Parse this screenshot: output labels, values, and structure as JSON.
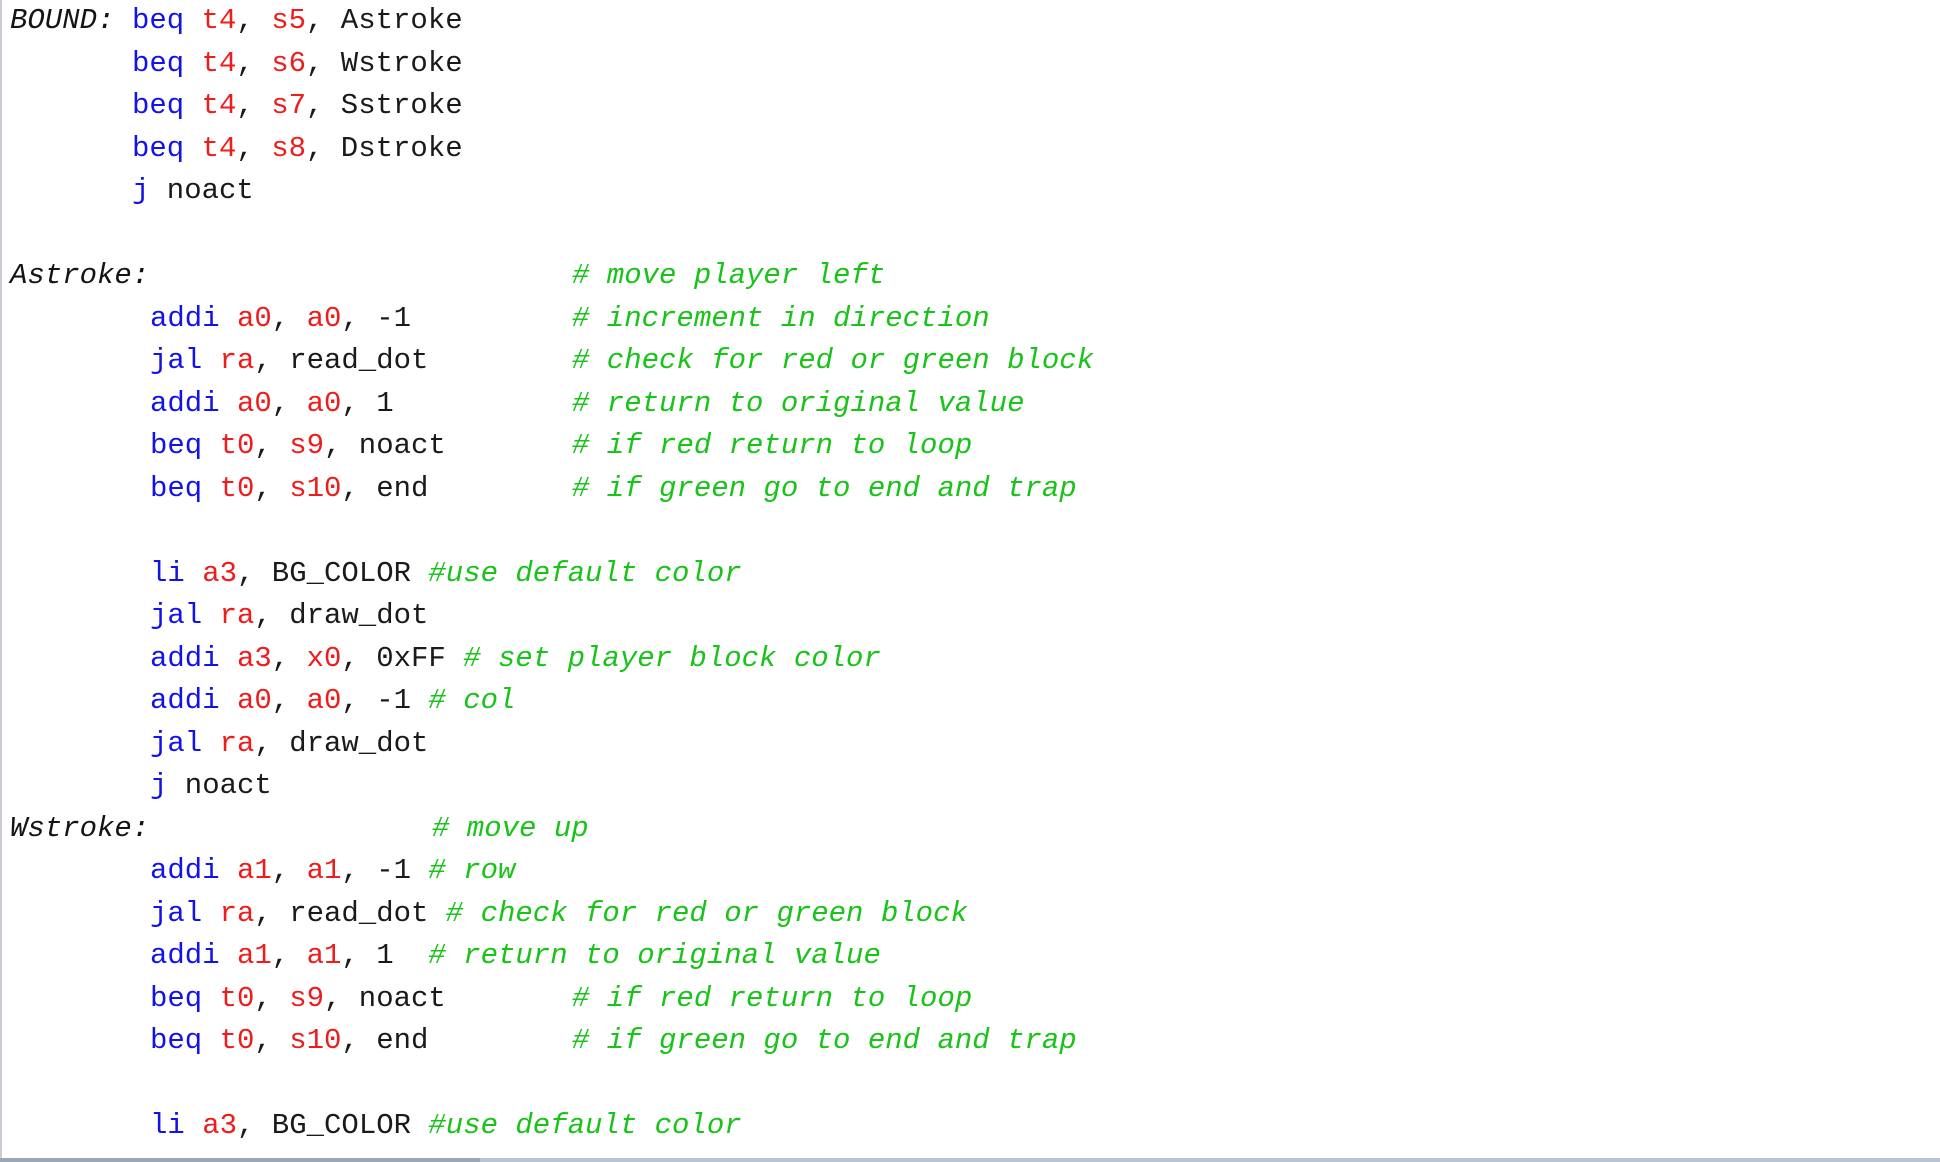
{
  "editor": {
    "lines": [
      {
        "label": "BOUND:",
        "indent": 0,
        "tokens": [
          {
            "t": "kw",
            "v": "beq"
          },
          {
            "t": "txt",
            "v": " "
          },
          {
            "t": "reg",
            "v": "t4"
          },
          {
            "t": "txt",
            "v": ", "
          },
          {
            "t": "reg",
            "v": "s5"
          },
          {
            "t": "txt",
            "v": ", Astroke"
          }
        ],
        "comment": ""
      },
      {
        "label": "",
        "indent": 0,
        "tokens": [
          {
            "t": "kw",
            "v": "beq"
          },
          {
            "t": "txt",
            "v": " "
          },
          {
            "t": "reg",
            "v": "t4"
          },
          {
            "t": "txt",
            "v": ", "
          },
          {
            "t": "reg",
            "v": "s6"
          },
          {
            "t": "txt",
            "v": ", Wstroke"
          }
        ],
        "comment": ""
      },
      {
        "label": "",
        "indent": 0,
        "tokens": [
          {
            "t": "kw",
            "v": "beq"
          },
          {
            "t": "txt",
            "v": " "
          },
          {
            "t": "reg",
            "v": "t4"
          },
          {
            "t": "txt",
            "v": ", "
          },
          {
            "t": "reg",
            "v": "s7"
          },
          {
            "t": "txt",
            "v": ", Sstroke"
          }
        ],
        "comment": ""
      },
      {
        "label": "",
        "indent": 0,
        "tokens": [
          {
            "t": "kw",
            "v": "beq"
          },
          {
            "t": "txt",
            "v": " "
          },
          {
            "t": "reg",
            "v": "t4"
          },
          {
            "t": "txt",
            "v": ", "
          },
          {
            "t": "reg",
            "v": "s8"
          },
          {
            "t": "txt",
            "v": ", Dstroke"
          }
        ],
        "comment": ""
      },
      {
        "label": "",
        "indent": 0,
        "tokens": [
          {
            "t": "kw",
            "v": "j"
          },
          {
            "t": "txt",
            "v": " noact"
          }
        ],
        "comment": ""
      },
      {
        "label": "",
        "indent": 0,
        "tokens": [],
        "comment": ""
      },
      {
        "label": "Astroke:",
        "indent": 0,
        "tokens": [],
        "comment": "# move player left"
      },
      {
        "label": "",
        "indent": 1,
        "tokens": [
          {
            "t": "kw",
            "v": "addi"
          },
          {
            "t": "txt",
            "v": " "
          },
          {
            "t": "reg",
            "v": "a0"
          },
          {
            "t": "txt",
            "v": ", "
          },
          {
            "t": "reg",
            "v": "a0"
          },
          {
            "t": "txt",
            "v": ", -1"
          }
        ],
        "comment": "# increment in direction"
      },
      {
        "label": "",
        "indent": 1,
        "tokens": [
          {
            "t": "kw",
            "v": "jal"
          },
          {
            "t": "txt",
            "v": " "
          },
          {
            "t": "reg",
            "v": "ra"
          },
          {
            "t": "txt",
            "v": ", read_dot"
          }
        ],
        "comment": "# check for red or green block"
      },
      {
        "label": "",
        "indent": 1,
        "tokens": [
          {
            "t": "kw",
            "v": "addi"
          },
          {
            "t": "txt",
            "v": " "
          },
          {
            "t": "reg",
            "v": "a0"
          },
          {
            "t": "txt",
            "v": ", "
          },
          {
            "t": "reg",
            "v": "a0"
          },
          {
            "t": "txt",
            "v": ", 1"
          }
        ],
        "comment": "# return to original value"
      },
      {
        "label": "",
        "indent": 1,
        "tokens": [
          {
            "t": "kw",
            "v": "beq"
          },
          {
            "t": "txt",
            "v": " "
          },
          {
            "t": "reg",
            "v": "t0"
          },
          {
            "t": "txt",
            "v": ", "
          },
          {
            "t": "reg",
            "v": "s9"
          },
          {
            "t": "txt",
            "v": ", noact"
          }
        ],
        "comment": "# if red return to loop"
      },
      {
        "label": "",
        "indent": 1,
        "tokens": [
          {
            "t": "kw",
            "v": "beq"
          },
          {
            "t": "txt",
            "v": " "
          },
          {
            "t": "reg",
            "v": "t0"
          },
          {
            "t": "txt",
            "v": ", "
          },
          {
            "t": "reg",
            "v": "s10"
          },
          {
            "t": "txt",
            "v": ", end"
          }
        ],
        "comment": "# if green go to end and trap"
      },
      {
        "label": "",
        "indent": 0,
        "tokens": [],
        "comment": ""
      },
      {
        "label": "",
        "indent": 1,
        "tokens": [
          {
            "t": "kw",
            "v": "li"
          },
          {
            "t": "txt",
            "v": " "
          },
          {
            "t": "reg",
            "v": "a3"
          },
          {
            "t": "txt",
            "v": ", BG_COLOR "
          },
          {
            "t": "cmt",
            "v": "#use default color"
          }
        ],
        "comment": ""
      },
      {
        "label": "",
        "indent": 1,
        "tokens": [
          {
            "t": "kw",
            "v": "jal"
          },
          {
            "t": "txt",
            "v": " "
          },
          {
            "t": "reg",
            "v": "ra"
          },
          {
            "t": "txt",
            "v": ", draw_dot"
          }
        ],
        "comment": ""
      },
      {
        "label": "",
        "indent": 1,
        "tokens": [
          {
            "t": "kw",
            "v": "addi"
          },
          {
            "t": "txt",
            "v": " "
          },
          {
            "t": "reg",
            "v": "a3"
          },
          {
            "t": "txt",
            "v": ", "
          },
          {
            "t": "reg",
            "v": "x0"
          },
          {
            "t": "txt",
            "v": ", 0xFF "
          },
          {
            "t": "cmt",
            "v": "# set player block color"
          }
        ],
        "comment": ""
      },
      {
        "label": "",
        "indent": 1,
        "tokens": [
          {
            "t": "kw",
            "v": "addi"
          },
          {
            "t": "txt",
            "v": " "
          },
          {
            "t": "reg",
            "v": "a0"
          },
          {
            "t": "txt",
            "v": ", "
          },
          {
            "t": "reg",
            "v": "a0"
          },
          {
            "t": "txt",
            "v": ", -1 "
          },
          {
            "t": "cmt",
            "v": "# col"
          }
        ],
        "comment": ""
      },
      {
        "label": "",
        "indent": 1,
        "tokens": [
          {
            "t": "kw",
            "v": "jal"
          },
          {
            "t": "txt",
            "v": " "
          },
          {
            "t": "reg",
            "v": "ra"
          },
          {
            "t": "txt",
            "v": ", draw_dot"
          }
        ],
        "comment": ""
      },
      {
        "label": "",
        "indent": 1,
        "tokens": [
          {
            "t": "kw",
            "v": "j"
          },
          {
            "t": "txt",
            "v": " noact"
          }
        ],
        "comment": ""
      },
      {
        "label": "Wstroke:",
        "indent": 0,
        "tokens": [],
        "comment": "# move up",
        "comment_col": "mid"
      },
      {
        "label": "",
        "indent": 1,
        "tokens": [
          {
            "t": "kw",
            "v": "addi"
          },
          {
            "t": "txt",
            "v": " "
          },
          {
            "t": "reg",
            "v": "a1"
          },
          {
            "t": "txt",
            "v": ", "
          },
          {
            "t": "reg",
            "v": "a1"
          },
          {
            "t": "txt",
            "v": ", -1 "
          },
          {
            "t": "cmt",
            "v": "# row"
          }
        ],
        "comment": ""
      },
      {
        "label": "",
        "indent": 1,
        "tokens": [
          {
            "t": "kw",
            "v": "jal"
          },
          {
            "t": "txt",
            "v": " "
          },
          {
            "t": "reg",
            "v": "ra"
          },
          {
            "t": "txt",
            "v": ", read_dot "
          },
          {
            "t": "cmt",
            "v": "# check for red or green block"
          }
        ],
        "comment": ""
      },
      {
        "label": "",
        "indent": 1,
        "tokens": [
          {
            "t": "kw",
            "v": "addi"
          },
          {
            "t": "txt",
            "v": " "
          },
          {
            "t": "reg",
            "v": "a1"
          },
          {
            "t": "txt",
            "v": ", "
          },
          {
            "t": "reg",
            "v": "a1"
          },
          {
            "t": "txt",
            "v": ", 1  "
          },
          {
            "t": "cmt",
            "v": "# return to original value"
          }
        ],
        "comment": ""
      },
      {
        "label": "",
        "indent": 1,
        "tokens": [
          {
            "t": "kw",
            "v": "beq"
          },
          {
            "t": "txt",
            "v": " "
          },
          {
            "t": "reg",
            "v": "t0"
          },
          {
            "t": "txt",
            "v": ", "
          },
          {
            "t": "reg",
            "v": "s9"
          },
          {
            "t": "txt",
            "v": ", noact"
          }
        ],
        "comment": "# if red return to loop"
      },
      {
        "label": "",
        "indent": 1,
        "tokens": [
          {
            "t": "kw",
            "v": "beq"
          },
          {
            "t": "txt",
            "v": " "
          },
          {
            "t": "reg",
            "v": "t0"
          },
          {
            "t": "txt",
            "v": ", "
          },
          {
            "t": "reg",
            "v": "s10"
          },
          {
            "t": "txt",
            "v": ", end"
          }
        ],
        "comment": "# if green go to end and trap"
      },
      {
        "label": "",
        "indent": 0,
        "tokens": [],
        "comment": ""
      },
      {
        "label": "",
        "indent": 1,
        "tokens": [
          {
            "t": "kw",
            "v": "li"
          },
          {
            "t": "txt",
            "v": " "
          },
          {
            "t": "reg",
            "v": "a3"
          },
          {
            "t": "txt",
            "v": ", BG_COLOR "
          },
          {
            "t": "cmt",
            "v": "#use default color"
          }
        ],
        "comment": ""
      }
    ]
  },
  "colors": {
    "keyword": "#1313e8",
    "register": "#ee1c1c",
    "comment": "#19c319",
    "text": "#1a1a1a",
    "background": "#ffffff"
  }
}
